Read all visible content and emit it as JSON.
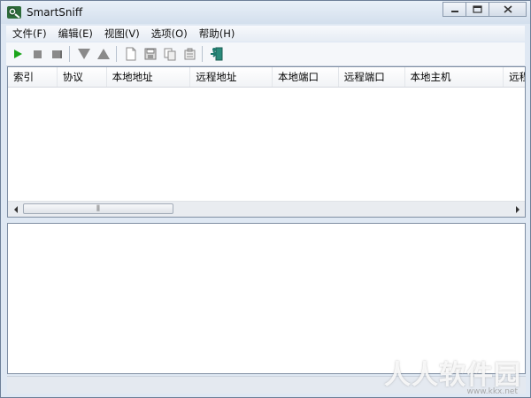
{
  "window": {
    "title": "SmartSniff",
    "controls": {
      "minimize": "minimize",
      "maximize": "maximize",
      "close": "close"
    }
  },
  "menu": {
    "items": [
      {
        "label": "文件(F)"
      },
      {
        "label": "编辑(E)"
      },
      {
        "label": "视图(V)"
      },
      {
        "label": "选项(O)"
      },
      {
        "label": "帮助(H)"
      }
    ]
  },
  "toolbar": {
    "buttons": [
      {
        "icon": "play-icon",
        "color": "#1aa51a"
      },
      {
        "icon": "stop-icon",
        "color": "#8a8a8a"
      },
      {
        "icon": "pause-icon",
        "color": "#8a8a8a"
      },
      {
        "icon": "triangle-down-icon",
        "color": "#8a8a8a"
      },
      {
        "icon": "triangle-up-icon",
        "color": "#8a8a8a"
      },
      {
        "icon": "new-file-icon",
        "color": "#8a8a8a"
      },
      {
        "icon": "save-icon",
        "color": "#8a8a8a"
      },
      {
        "icon": "copy-icon",
        "color": "#8a8a8a"
      },
      {
        "icon": "properties-icon",
        "color": "#8a8a8a"
      },
      {
        "icon": "exit-icon",
        "color": "#1e7a6e"
      }
    ]
  },
  "table": {
    "columns": [
      {
        "label": "索引"
      },
      {
        "label": "协议"
      },
      {
        "label": "本地地址"
      },
      {
        "label": "远程地址"
      },
      {
        "label": "本地端口"
      },
      {
        "label": "远程端口"
      },
      {
        "label": "本地主机"
      },
      {
        "label": "远程"
      }
    ],
    "rows": []
  },
  "scrollbar": {
    "grip": "⫼"
  },
  "statusbar": {
    "text": ""
  },
  "watermark": {
    "text": "人人软件园",
    "url": "www.kkx.net"
  }
}
